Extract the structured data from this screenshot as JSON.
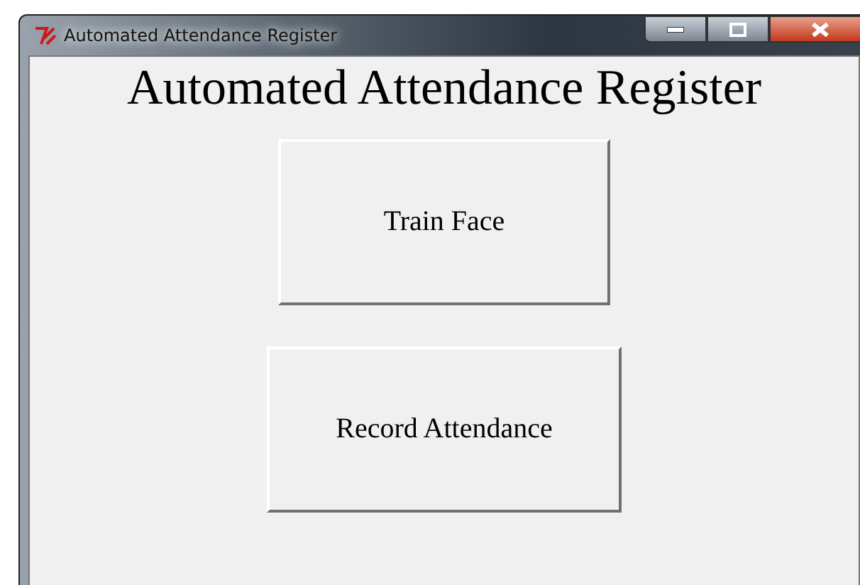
{
  "window": {
    "title": "Automated Attendance Register"
  },
  "heading": "Automated Attendance Register",
  "buttons": [
    "Train Face",
    "Record Attendance"
  ]
}
